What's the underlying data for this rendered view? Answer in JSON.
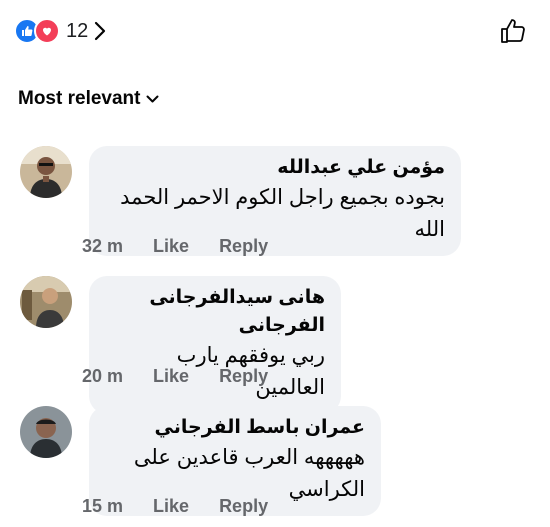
{
  "reactions": {
    "count": "12"
  },
  "sort": {
    "label": "Most relevant"
  },
  "comments": [
    {
      "author": "مؤمن علي عبدالله",
      "text": "بجوده بجميع راجل الكوم الاحمر الحمد الله",
      "time": "32 m",
      "like": "Like",
      "reply": "Reply"
    },
    {
      "author": "هانى سيدالفرجانى الفرجانى",
      "text": "ربي يوفقهم يارب العالمين",
      "time": "20 m",
      "like": "Like",
      "reply": "Reply"
    },
    {
      "author": "عمران باسط الفرجاني",
      "text": "هههههه العرب قاعدين على الكراسي",
      "time": "15 m",
      "like": "Like",
      "reply": "Reply"
    }
  ]
}
